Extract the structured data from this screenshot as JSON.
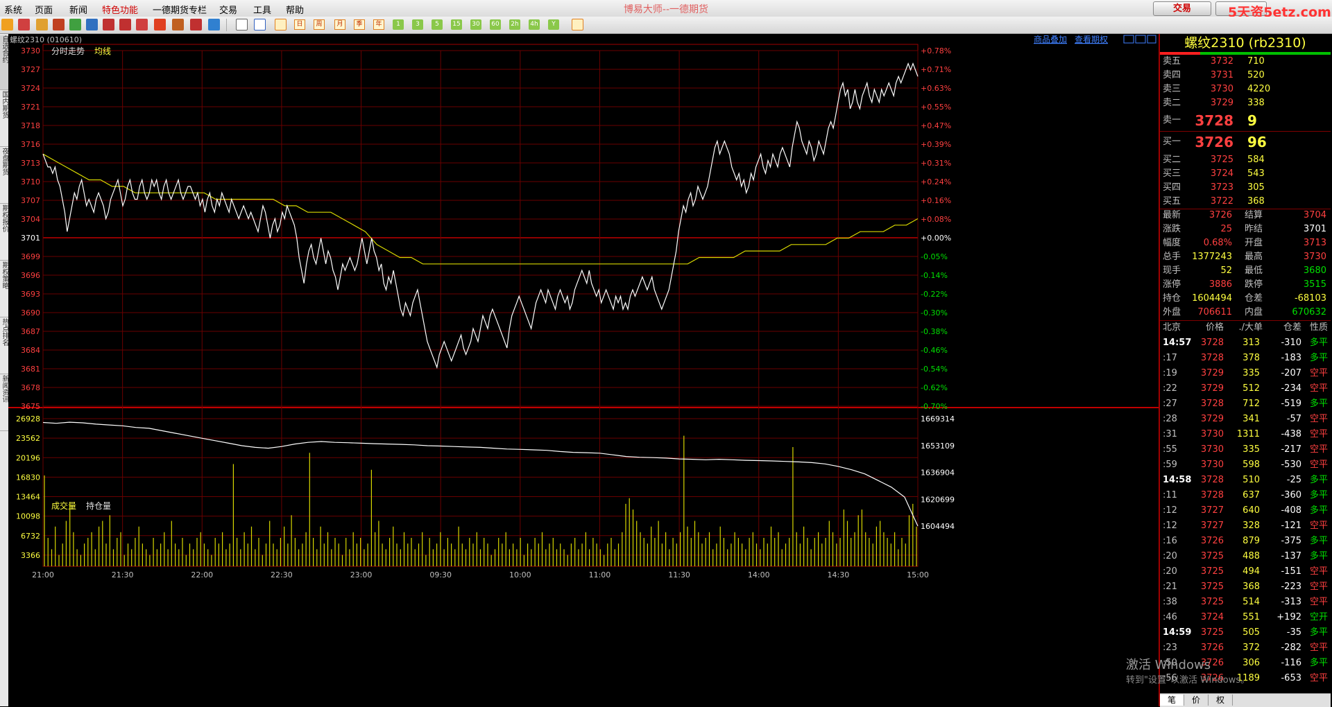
{
  "menu": {
    "items": [
      "系统",
      "页面",
      "新闻",
      "特色功能",
      "一德期货专栏",
      "交易",
      "工具",
      "帮助"
    ],
    "app_title": "博易大师--一德期货",
    "trade_button": "交易",
    "watermark": "5天资5etz.com"
  },
  "toolbar": {
    "period_labels": [
      "日",
      "周",
      "月",
      "季",
      "年"
    ],
    "minute_labels": [
      "1",
      "3",
      "5",
      "15",
      "30",
      "60",
      "2h",
      "4h",
      "Y"
    ]
  },
  "left_tabs": [
    "自选合约",
    "国内期货",
    "夜盘期货",
    "期权报价",
    "期权策略",
    "热点排名",
    "新闻资讯"
  ],
  "chart_header": {
    "symbol": "螺纹2310 (010610)",
    "link_overlay": "商品叠加",
    "link_option": "查看期权",
    "label_trend": "分时走势",
    "label_avg": "均线",
    "label_volume": "成交量",
    "label_oi": "持仓量"
  },
  "chart_data": {
    "type": "line",
    "price_axis": {
      "ticks": [
        "3730",
        "3727",
        "3724",
        "3721",
        "3718",
        "3716",
        "3713",
        "3710",
        "3707",
        "3704",
        "3701",
        "3699",
        "3696",
        "3693",
        "3690",
        "3687",
        "3684",
        "3681",
        "3678",
        "3675"
      ],
      "min": 3675,
      "max": 3730,
      "pre_settle": 3701
    },
    "pct_ticks": [
      "+0.78%",
      "+0.71%",
      "+0.63%",
      "+0.55%",
      "+0.47%",
      "+0.39%",
      "+0.31%",
      "+0.24%",
      "+0.16%",
      "+0.08%",
      "+0.00%",
      "-0.05%",
      "-0.14%",
      "-0.22%",
      "-0.30%",
      "-0.38%",
      "-0.46%",
      "-0.54%",
      "-0.62%",
      "-0.70%"
    ],
    "time_labels": [
      "21:00",
      "21:30",
      "22:00",
      "22:30",
      "23:00",
      "09:30",
      "10:00",
      "11:00",
      "11:30",
      "14:00",
      "14:30",
      "15:00"
    ],
    "volume_ticks": [
      "26928",
      "23562",
      "20196",
      "16830",
      "13464",
      "10098",
      "6732",
      "3366"
    ],
    "oi_ticks": [
      "1669314",
      "1653109",
      "1636904",
      "1620699",
      "1604494"
    ],
    "price_series": [
      3714,
      3713,
      3712,
      3712,
      3711,
      3712,
      3710,
      3709,
      3707,
      3705,
      3702,
      3704,
      3706,
      3708,
      3707,
      3709,
      3710,
      3708,
      3706,
      3707,
      3706,
      3705,
      3707,
      3708,
      3707,
      3706,
      3704,
      3705,
      3707,
      3708,
      3709,
      3710,
      3708,
      3706,
      3707,
      3709,
      3710,
      3708,
      3707,
      3707,
      3709,
      3710,
      3708,
      3707,
      3708,
      3710,
      3709,
      3710,
      3708,
      3707,
      3709,
      3710,
      3708,
      3707,
      3708,
      3709,
      3710,
      3708,
      3707,
      3708,
      3709,
      3709,
      3708,
      3707,
      3708,
      3706,
      3707,
      3705,
      3707,
      3708,
      3706,
      3705,
      3707,
      3706,
      3708,
      3707,
      3706,
      3705,
      3707,
      3706,
      3705,
      3704,
      3705,
      3706,
      3705,
      3704,
      3705,
      3704,
      3703,
      3702,
      3704,
      3706,
      3705,
      3703,
      3701,
      3703,
      3704,
      3702,
      3703,
      3705,
      3704,
      3706,
      3705,
      3704,
      3703,
      3701,
      3698,
      3696,
      3694,
      3697,
      3699,
      3700,
      3698,
      3697,
      3699,
      3701,
      3699,
      3697,
      3699,
      3698,
      3696,
      3695,
      3693,
      3695,
      3697,
      3696,
      3697,
      3698,
      3697,
      3696,
      3697,
      3699,
      3701,
      3699,
      3697,
      3699,
      3701,
      3699,
      3698,
      3696,
      3697,
      3694,
      3693,
      3695,
      3694,
      3696,
      3694,
      3692,
      3690,
      3689,
      3691,
      3690,
      3689,
      3691,
      3692,
      3693,
      3691,
      3689,
      3687,
      3685,
      3684,
      3683,
      3682,
      3681,
      3683,
      3684,
      3685,
      3684,
      3683,
      3682,
      3683,
      3684,
      3685,
      3686,
      3684,
      3683,
      3684,
      3685,
      3687,
      3686,
      3685,
      3687,
      3689,
      3688,
      3687,
      3689,
      3690,
      3689,
      3688,
      3687,
      3686,
      3685,
      3684,
      3687,
      3689,
      3690,
      3691,
      3692,
      3691,
      3690,
      3689,
      3688,
      3687,
      3689,
      3691,
      3692,
      3693,
      3692,
      3691,
      3693,
      3692,
      3691,
      3690,
      3692,
      3693,
      3692,
      3691,
      3692,
      3690,
      3691,
      3693,
      3694,
      3695,
      3696,
      3695,
      3694,
      3696,
      3694,
      3693,
      3692,
      3693,
      3691,
      3692,
      3693,
      3692,
      3691,
      3690,
      3692,
      3691,
      3692,
      3690,
      3691,
      3690,
      3692,
      3693,
      3692,
      3693,
      3694,
      3695,
      3694,
      3693,
      3694,
      3695,
      3693,
      3692,
      3691,
      3690,
      3691,
      3692,
      3693,
      3695,
      3697,
      3699,
      3702,
      3704,
      3706,
      3705,
      3707,
      3708,
      3706,
      3707,
      3709,
      3708,
      3707,
      3708,
      3709,
      3711,
      3713,
      3715,
      3716,
      3714,
      3715,
      3716,
      3715,
      3714,
      3712,
      3711,
      3710,
      3711,
      3709,
      3710,
      3708,
      3709,
      3711,
      3710,
      3712,
      3713,
      3714,
      3712,
      3711,
      3713,
      3712,
      3714,
      3713,
      3712,
      3714,
      3715,
      3714,
      3713,
      3712,
      3715,
      3717,
      3719,
      3718,
      3716,
      3715,
      3714,
      3716,
      3715,
      3713,
      3714,
      3716,
      3715,
      3714,
      3716,
      3718,
      3719,
      3718,
      3720,
      3722,
      3724,
      3725,
      3723,
      3724,
      3721,
      3722,
      3724,
      3722,
      3721,
      3723,
      3724,
      3725,
      3723,
      3722,
      3724,
      3723,
      3722,
      3724,
      3723,
      3724,
      3725,
      3724,
      3723,
      3725,
      3726,
      3725,
      3726,
      3727,
      3728,
      3727,
      3728,
      3727,
      3726
    ],
    "avg_series": [
      3714,
      3713,
      3712,
      3711,
      3710,
      3710,
      3709,
      3709,
      3708,
      3708,
      3708,
      3708,
      3708,
      3708,
      3708,
      3707,
      3707,
      3707,
      3707,
      3707,
      3707,
      3706,
      3706,
      3705,
      3705,
      3705,
      3704,
      3703,
      3702,
      3700,
      3699,
      3698,
      3698,
      3697,
      3697,
      3697,
      3697,
      3697,
      3697,
      3697,
      3697,
      3697,
      3697,
      3697,
      3697,
      3697,
      3697,
      3697,
      3697,
      3697,
      3697,
      3697,
      3697,
      3697,
      3697,
      3697,
      3697,
      3698,
      3698,
      3698,
      3698,
      3699,
      3699,
      3699,
      3699,
      3700,
      3700,
      3700,
      3700,
      3701,
      3701,
      3702,
      3702,
      3702,
      3703,
      3703,
      3704
    ],
    "volume_series": [
      16,
      5,
      3,
      7,
      2,
      4,
      8,
      11,
      6,
      3,
      2,
      4,
      5,
      6,
      3,
      7,
      8,
      4,
      9,
      3,
      5,
      6,
      2,
      4,
      3,
      5,
      7,
      4,
      3,
      2,
      5,
      3,
      4,
      6,
      3,
      8,
      4,
      3,
      5,
      2,
      4,
      3,
      5,
      6,
      4,
      3,
      2,
      5,
      4,
      6,
      3,
      4,
      18,
      5,
      3,
      6,
      4,
      7,
      3,
      5,
      2,
      4,
      8,
      4,
      3,
      5,
      7,
      4,
      9,
      5,
      3,
      4,
      6,
      20,
      5,
      3,
      7,
      4,
      6,
      3,
      5,
      4,
      2,
      5,
      3,
      6,
      4,
      5,
      3,
      4,
      17,
      6,
      8,
      4,
      3,
      5,
      7,
      4,
      3,
      6,
      4,
      5,
      3,
      4,
      6,
      2,
      5,
      3,
      4,
      6,
      3,
      5,
      4,
      3,
      7,
      4,
      3,
      5,
      4,
      6,
      3,
      5,
      4,
      2,
      3,
      5,
      4,
      6,
      3,
      4,
      3,
      5,
      2,
      4,
      3,
      5,
      4,
      6,
      3,
      4,
      5,
      3,
      4,
      3,
      2,
      4,
      5,
      3,
      4,
      6,
      3,
      5,
      4,
      3,
      2,
      4,
      5,
      3,
      4,
      6,
      11,
      12,
      10,
      8,
      6,
      5,
      4,
      7,
      5,
      8,
      4,
      6,
      3,
      5,
      4,
      6,
      23,
      7,
      5,
      8,
      6,
      4,
      5,
      6,
      3,
      4,
      7,
      5,
      3,
      4,
      6,
      5,
      4,
      3,
      5,
      6,
      4,
      3,
      5,
      4,
      7,
      5,
      6,
      3,
      4,
      5,
      21,
      6,
      4,
      7,
      5,
      3,
      5,
      6,
      4,
      5,
      8,
      6,
      4,
      5,
      10,
      8,
      5,
      6,
      9,
      10,
      6,
      5,
      4,
      7,
      8,
      6,
      5,
      4,
      6,
      3,
      5,
      4,
      9,
      11,
      7
    ],
    "oi_series": [
      1667000,
      1666500,
      1667200,
      1666800,
      1666000,
      1665500,
      1665000,
      1664000,
      1663500,
      1662000,
      1660500,
      1659000,
      1657500,
      1656000,
      1654500,
      1653000,
      1652000,
      1651500,
      1652500,
      1654000,
      1655000,
      1655500,
      1655000,
      1654800,
      1654500,
      1654200,
      1654000,
      1653800,
      1653500,
      1653000,
      1652800,
      1652500,
      1652200,
      1652000,
      1651500,
      1651000,
      1650800,
      1650500,
      1650200,
      1649500,
      1649000,
      1648800,
      1648500,
      1647500,
      1646500,
      1646000,
      1645800,
      1645500,
      1645000,
      1644800,
      1644500,
      1644800,
      1644500,
      1644200,
      1644000,
      1643800,
      1643500,
      1643200,
      1642800,
      1642000,
      1640500,
      1638500,
      1636000,
      1632000,
      1628000,
      1622000,
      1604494
    ]
  },
  "panel": {
    "title": "螺纹2310 (rb2310)",
    "asks": [
      {
        "label": "卖五",
        "price": "3732",
        "vol": "710"
      },
      {
        "label": "卖四",
        "price": "3731",
        "vol": "520"
      },
      {
        "label": "卖三",
        "price": "3730",
        "vol": "4220"
      },
      {
        "label": "卖二",
        "price": "3729",
        "vol": "338"
      },
      {
        "label": "卖一",
        "price": "3728",
        "vol": "9"
      }
    ],
    "bids": [
      {
        "label": "买一",
        "price": "3726",
        "vol": "96"
      },
      {
        "label": "买二",
        "price": "3725",
        "vol": "584"
      },
      {
        "label": "买三",
        "price": "3724",
        "vol": "543"
      },
      {
        "label": "买四",
        "price": "3723",
        "vol": "305"
      },
      {
        "label": "买五",
        "price": "3722",
        "vol": "368"
      }
    ],
    "stats": [
      {
        "l1": "最新",
        "v1": "3726",
        "c1": "#ff4040",
        "l2": "结算",
        "v2": "3704",
        "c2": "#ff4040"
      },
      {
        "l1": "涨跌",
        "v1": "25",
        "c1": "#ff4040",
        "l2": "昨结",
        "v2": "3701",
        "c2": "#ffffff"
      },
      {
        "l1": "幅度",
        "v1": "0.68%",
        "c1": "#ff4040",
        "l2": "开盘",
        "v2": "3713",
        "c2": "#ff4040"
      },
      {
        "l1": "总手",
        "v1": "1377243",
        "c1": "#ffff40",
        "l2": "最高",
        "v2": "3730",
        "c2": "#ff4040"
      },
      {
        "l1": "现手",
        "v1": "52",
        "c1": "#ffff40",
        "l2": "最低",
        "v2": "3680",
        "c2": "#00e000"
      },
      {
        "l1": "涨停",
        "v1": "3886",
        "c1": "#ff4040",
        "l2": "跌停",
        "v2": "3515",
        "c2": "#00e000"
      },
      {
        "l1": "持仓",
        "v1": "1604494",
        "c1": "#ffff40",
        "l2": "仓差",
        "v2": "-68103",
        "c2": "#ffff40"
      },
      {
        "l1": "外盘",
        "v1": "706611",
        "c1": "#ff4040",
        "l2": "内盘",
        "v2": "670632",
        "c2": "#00e000"
      }
    ],
    "tick_header": {
      "time": "北京",
      "price": "价格",
      "vol": "./大单",
      "oi": "仓差",
      "nature": "性质"
    },
    "ticks": [
      {
        "time": "14:57",
        "major": true,
        "price": "3728",
        "vol": "313",
        "oi": "-310",
        "nature": "多平",
        "nc": "#00e000"
      },
      {
        "time": ":17",
        "major": false,
        "price": "3728",
        "vol": "378",
        "oi": "-183",
        "nature": "多平",
        "nc": "#00e000"
      },
      {
        "time": ":19",
        "major": false,
        "price": "3729",
        "vol": "335",
        "oi": "-207",
        "nature": "空平",
        "nc": "#ff4040"
      },
      {
        "time": ":22",
        "major": false,
        "price": "3729",
        "vol": "512",
        "oi": "-234",
        "nature": "空平",
        "nc": "#ff4040"
      },
      {
        "time": ":27",
        "major": false,
        "price": "3728",
        "vol": "712",
        "oi": "-519",
        "nature": "多平",
        "nc": "#00e000"
      },
      {
        "time": ":28",
        "major": false,
        "price": "3729",
        "vol": "341",
        "oi": "-57",
        "nature": "空平",
        "nc": "#ff4040"
      },
      {
        "time": ":31",
        "major": false,
        "price": "3730",
        "vol": "1311",
        "oi": "-438",
        "nature": "空平",
        "nc": "#ff4040"
      },
      {
        "time": ":55",
        "major": false,
        "price": "3730",
        "vol": "335",
        "oi": "-217",
        "nature": "空平",
        "nc": "#ff4040"
      },
      {
        "time": ":59",
        "major": false,
        "price": "3730",
        "vol": "598",
        "oi": "-530",
        "nature": "空平",
        "nc": "#ff4040"
      },
      {
        "time": "14:58",
        "major": true,
        "price": "3728",
        "vol": "510",
        "oi": "-25",
        "nature": "多平",
        "nc": "#00e000"
      },
      {
        "time": ":11",
        "major": false,
        "price": "3728",
        "vol": "637",
        "oi": "-360",
        "nature": "多平",
        "nc": "#00e000"
      },
      {
        "time": ":12",
        "major": false,
        "price": "3727",
        "vol": "640",
        "oi": "-408",
        "nature": "多平",
        "nc": "#00e000"
      },
      {
        "time": ":12",
        "major": false,
        "price": "3727",
        "vol": "328",
        "oi": "-121",
        "nature": "空平",
        "nc": "#ff4040"
      },
      {
        "time": ":16",
        "major": false,
        "price": "3726",
        "vol": "879",
        "oi": "-375",
        "nature": "多平",
        "nc": "#00e000"
      },
      {
        "time": ":20",
        "major": false,
        "price": "3725",
        "vol": "488",
        "oi": "-137",
        "nature": "多平",
        "nc": "#00e000"
      },
      {
        "time": ":20",
        "major": false,
        "price": "3725",
        "vol": "494",
        "oi": "-151",
        "nature": "空平",
        "nc": "#ff4040"
      },
      {
        "time": ":21",
        "major": false,
        "price": "3725",
        "vol": "368",
        "oi": "-223",
        "nature": "空平",
        "nc": "#ff4040"
      },
      {
        "time": ":38",
        "major": false,
        "price": "3725",
        "vol": "514",
        "oi": "-313",
        "nature": "空平",
        "nc": "#ff4040"
      },
      {
        "time": ":46",
        "major": false,
        "price": "3724",
        "vol": "551",
        "oi": "+192",
        "nature": "空开",
        "nc": "#00e000"
      },
      {
        "time": "14:59",
        "major": true,
        "price": "3725",
        "vol": "505",
        "oi": "-35",
        "nature": "多平",
        "nc": "#00e000"
      },
      {
        "time": ":23",
        "major": false,
        "price": "3726",
        "vol": "372",
        "oi": "-282",
        "nature": "空平",
        "nc": "#ff4040"
      },
      {
        "time": ":50",
        "major": false,
        "price": "3726",
        "vol": "306",
        "oi": "-116",
        "nature": "多平",
        "nc": "#00e000"
      },
      {
        "time": ":56",
        "major": false,
        "price": "3726",
        "vol": "1189",
        "oi": "-653",
        "nature": "空平",
        "nc": "#ff4040"
      }
    ],
    "bottom_tabs": [
      "笔",
      "价",
      "权"
    ]
  },
  "windows_notice": {
    "line1": "激活 Windows",
    "line2": "转到\"设置\"以激活 Windows。"
  }
}
